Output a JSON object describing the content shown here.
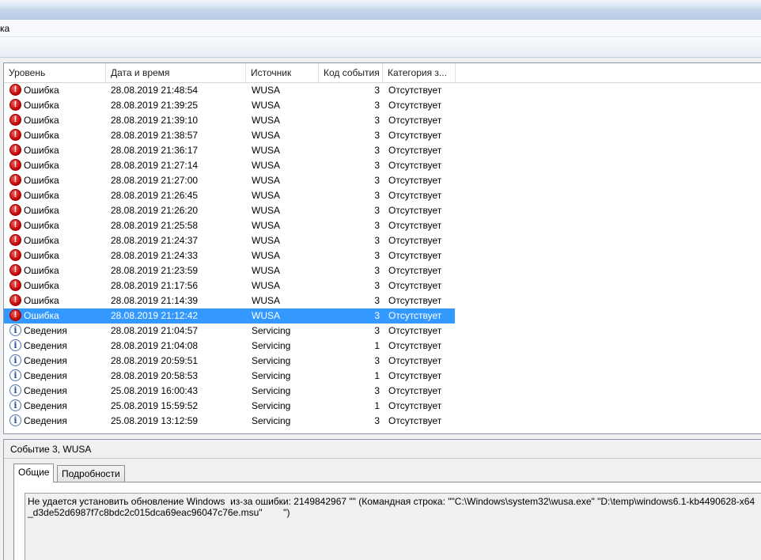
{
  "window": {
    "menu_partial_label": "ка"
  },
  "grid": {
    "columns": [
      "Уровень",
      "Дата и время",
      "Источник",
      "Код события",
      "Категория з..."
    ],
    "rows": [
      {
        "level": "Ошибка",
        "icon": "error-icon",
        "date": "28.08.2019 21:48:54",
        "source": "WUSA",
        "code": "3",
        "category": "Отсутствует"
      },
      {
        "level": "Ошибка",
        "icon": "error-icon",
        "date": "28.08.2019 21:39:25",
        "source": "WUSA",
        "code": "3",
        "category": "Отсутствует"
      },
      {
        "level": "Ошибка",
        "icon": "error-icon",
        "date": "28.08.2019 21:39:10",
        "source": "WUSA",
        "code": "3",
        "category": "Отсутствует"
      },
      {
        "level": "Ошибка",
        "icon": "error-icon",
        "date": "28.08.2019 21:38:57",
        "source": "WUSA",
        "code": "3",
        "category": "Отсутствует"
      },
      {
        "level": "Ошибка",
        "icon": "error-icon",
        "date": "28.08.2019 21:36:17",
        "source": "WUSA",
        "code": "3",
        "category": "Отсутствует"
      },
      {
        "level": "Ошибка",
        "icon": "error-icon",
        "date": "28.08.2019 21:27:14",
        "source": "WUSA",
        "code": "3",
        "category": "Отсутствует"
      },
      {
        "level": "Ошибка",
        "icon": "error-icon",
        "date": "28.08.2019 21:27:00",
        "source": "WUSA",
        "code": "3",
        "category": "Отсутствует"
      },
      {
        "level": "Ошибка",
        "icon": "error-icon",
        "date": "28.08.2019 21:26:45",
        "source": "WUSA",
        "code": "3",
        "category": "Отсутствует"
      },
      {
        "level": "Ошибка",
        "icon": "error-icon",
        "date": "28.08.2019 21:26:20",
        "source": "WUSA",
        "code": "3",
        "category": "Отсутствует"
      },
      {
        "level": "Ошибка",
        "icon": "error-icon",
        "date": "28.08.2019 21:25:58",
        "source": "WUSA",
        "code": "3",
        "category": "Отсутствует"
      },
      {
        "level": "Ошибка",
        "icon": "error-icon",
        "date": "28.08.2019 21:24:37",
        "source": "WUSA",
        "code": "3",
        "category": "Отсутствует"
      },
      {
        "level": "Ошибка",
        "icon": "error-icon",
        "date": "28.08.2019 21:24:33",
        "source": "WUSA",
        "code": "3",
        "category": "Отсутствует"
      },
      {
        "level": "Ошибка",
        "icon": "error-icon",
        "date": "28.08.2019 21:23:59",
        "source": "WUSA",
        "code": "3",
        "category": "Отсутствует"
      },
      {
        "level": "Ошибка",
        "icon": "error-icon",
        "date": "28.08.2019 21:17:56",
        "source": "WUSA",
        "code": "3",
        "category": "Отсутствует"
      },
      {
        "level": "Ошибка",
        "icon": "error-icon",
        "date": "28.08.2019 21:14:39",
        "source": "WUSA",
        "code": "3",
        "category": "Отсутствует"
      },
      {
        "level": "Ошибка",
        "icon": "error-icon",
        "date": "28.08.2019 21:12:42",
        "source": "WUSA",
        "code": "3",
        "category": "Отсутствует",
        "selected": true
      },
      {
        "level": "Сведения",
        "icon": "info-icon",
        "date": "28.08.2019 21:04:57",
        "source": "Servicing",
        "code": "3",
        "category": "Отсутствует"
      },
      {
        "level": "Сведения",
        "icon": "info-icon",
        "date": "28.08.2019 21:04:08",
        "source": "Servicing",
        "code": "1",
        "category": "Отсутствует"
      },
      {
        "level": "Сведения",
        "icon": "info-icon",
        "date": "28.08.2019 20:59:51",
        "source": "Servicing",
        "code": "3",
        "category": "Отсутствует"
      },
      {
        "level": "Сведения",
        "icon": "info-icon",
        "date": "28.08.2019 20:58:53",
        "source": "Servicing",
        "code": "1",
        "category": "Отсутствует"
      },
      {
        "level": "Сведения",
        "icon": "info-icon",
        "date": "25.08.2019 16:00:43",
        "source": "Servicing",
        "code": "3",
        "category": "Отсутствует"
      },
      {
        "level": "Сведения",
        "icon": "info-icon",
        "date": "25.08.2019 15:59:52",
        "source": "Servicing",
        "code": "1",
        "category": "Отсутствует"
      },
      {
        "level": "Сведения",
        "icon": "info-icon",
        "date": "25.08.2019 13:12:59",
        "source": "Servicing",
        "code": "3",
        "category": "Отсутствует"
      }
    ]
  },
  "detail": {
    "title": "Событие 3, WUSA",
    "tabs": [
      "Общие",
      "Подробности"
    ],
    "message": "Не удается установить обновление Windows  из-за ошибки: 2149842967 \"\" (Командная строка: \"\"C:\\Windows\\system32\\wusa.exe\" \"D:\\temp\\windows6.1-kb4490628-x64_d3de52d6987f7c8bdc2c015dca69eac96047c76e.msu\"        \")"
  },
  "colors": {
    "selection": "#3399ff"
  }
}
